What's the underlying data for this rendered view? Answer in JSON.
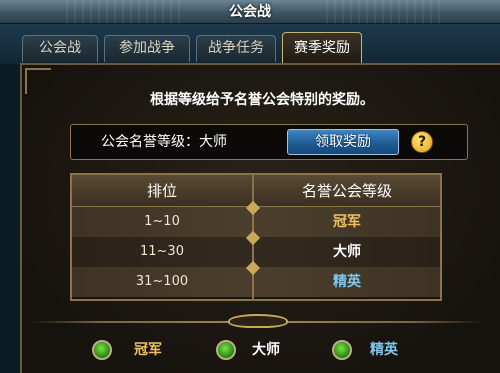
{
  "window": {
    "title": "公会战"
  },
  "tabs": [
    {
      "label": "公会战",
      "active": false
    },
    {
      "label": "参加战争",
      "active": false
    },
    {
      "label": "战争任务",
      "active": false
    },
    {
      "label": "赛季奖励",
      "active": true
    }
  ],
  "intro_text": "根据等级给予名誉公会特别的奖励。",
  "honor_rank": {
    "label": "公会名誉等级：大师",
    "claim_button": "领取奖励",
    "help_glyph": "?"
  },
  "table": {
    "headers": [
      "排位",
      "名誉公会等级"
    ],
    "rows": [
      {
        "rank": "1~10",
        "tier": "冠军",
        "tier_color": "#f0c060"
      },
      {
        "rank": "11~30",
        "tier": "大师",
        "tier_color": "#ffffff"
      },
      {
        "rank": "31~100",
        "tier": "精英",
        "tier_color": "#7ec8f0"
      }
    ]
  },
  "legend": [
    {
      "label": "冠军",
      "color": "#f0c060",
      "icon": "green-orb-icon"
    },
    {
      "label": "大师",
      "color": "#ffffff",
      "icon": "green-orb-icon"
    },
    {
      "label": "精英",
      "color": "#7ec8f0",
      "icon": "green-orb-icon"
    }
  ]
}
